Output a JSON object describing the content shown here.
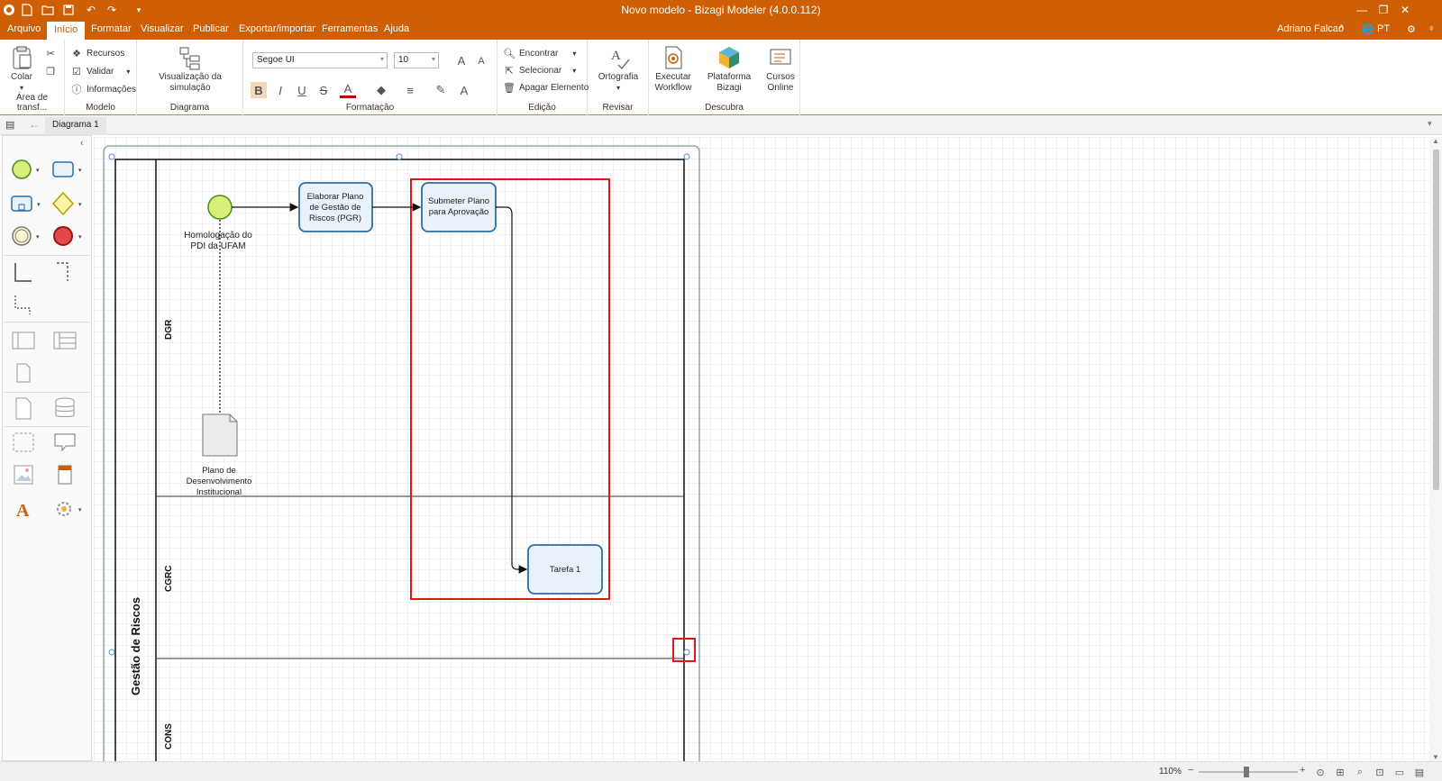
{
  "window": {
    "title": "Novo modelo - Bizagi Modeler (4.0.0.112)",
    "brand_color": "#cf5f05"
  },
  "menu": {
    "items": [
      "Arquivo",
      "Início",
      "Formatar",
      "Visualizar",
      "Publicar",
      "Exportar/importar",
      "Ferramentas",
      "Ajuda"
    ],
    "active": "Início",
    "user": "Adriano Falcao",
    "language": "PT"
  },
  "ribbon": {
    "clipboard": {
      "paste_label": "Colar",
      "group_label": "Área de transf..."
    },
    "model": {
      "resources": "Recursos",
      "validate": "Validar",
      "info": "Informações",
      "group_label": "Modelo"
    },
    "diagram": {
      "simulation": "Visualização da simulação",
      "group_label": "Diagrama"
    },
    "format": {
      "font_family": "Segoe UI",
      "font_size": "10",
      "group_label": "Formatação"
    },
    "edit": {
      "find": "Encontrar",
      "select": "Selecionar",
      "delete": "Apagar Elemento",
      "group_label": "Edição"
    },
    "review": {
      "spelling": "Ortografia",
      "group_label": "Revisar"
    },
    "discover": {
      "exec_line1": "Executar",
      "exec_line2": "Workflow",
      "platform": "Plataforma Bizagi",
      "courses_line1": "Cursos",
      "courses_line2": "Online",
      "group_label": "Descubra"
    }
  },
  "tabs": {
    "diagram_tab": "Diagrama 1"
  },
  "diagram": {
    "pool_name": "Gestão de Riscos",
    "lanes": [
      "DGR",
      "CGRC",
      "CONS"
    ],
    "start_event_label_line1": "Homologação do",
    "start_event_label_line2": "PDI da UFAM",
    "task1_line1": "Elaborar Plano",
    "task1_line2": "de Gestão de",
    "task1_line3": "Riscos (PGR)",
    "task2_line1": "Submeter Plano",
    "task2_line2": "para Aprovação",
    "task3": "Tarefa 1",
    "doc_line1": "Plano de",
    "doc_line2": "Desenvolvimento",
    "doc_line3": "Institucional",
    "highlight_color": "#e0161b",
    "task_fill": "#e9f1fb",
    "task_stroke": "#2d6da3",
    "start_fill": "#d8f07a"
  },
  "status": {
    "zoom": "110%"
  }
}
